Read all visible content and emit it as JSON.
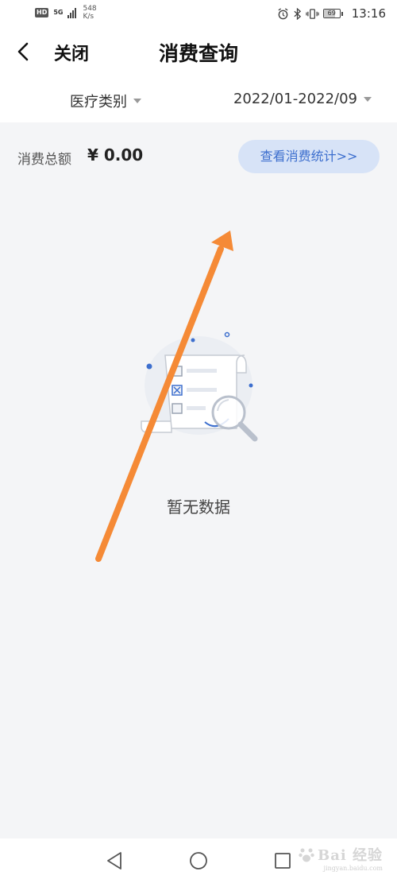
{
  "status_bar": {
    "hd": "HD",
    "network_type": "5G",
    "speed_value": "548",
    "speed_unit": "K/s",
    "battery_level": "69",
    "time": "13:16"
  },
  "header": {
    "close_label": "关闭",
    "title": "消费查询"
  },
  "filters": {
    "category_label": "医疗类别",
    "date_range_label": "2022/01-2022/09"
  },
  "summary": {
    "label": "消费总额",
    "amount": "¥ 0.00",
    "stats_button_label": "查看消费统计>>"
  },
  "empty_state": {
    "message": "暂无数据"
  },
  "watermark": {
    "text": "Bai 经验",
    "sub": "jingyan.baidu.com"
  },
  "colors": {
    "accent": "#3d6fce",
    "stats_button_bg": "#d7e3f7",
    "page_bg": "#f4f5f7",
    "annotation_arrow": "#f58a36"
  }
}
